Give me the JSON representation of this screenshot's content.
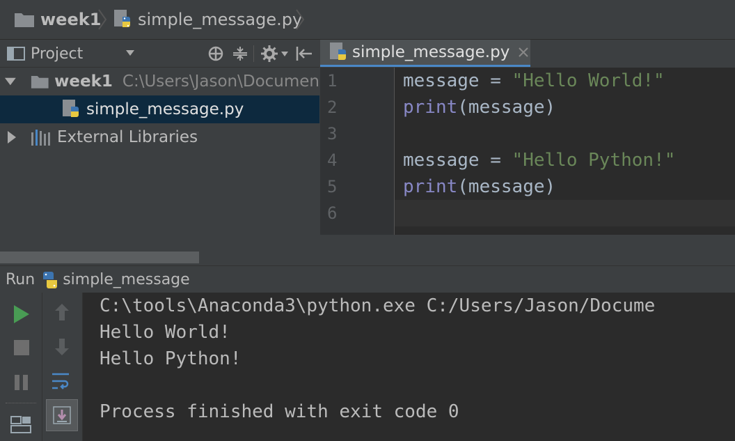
{
  "breadcrumb": {
    "project": "week1",
    "file": "simple_message.py"
  },
  "project_panel": {
    "title": "Project",
    "tree": [
      {
        "label": "week1",
        "path": "C:\\Users\\Jason\\Documen"
      },
      {
        "label": "simple_message.py"
      },
      {
        "label": "External Libraries"
      }
    ]
  },
  "editor": {
    "tab_label": "simple_message.py",
    "line_numbers": [
      "1",
      "2",
      "3",
      "4",
      "5",
      "6"
    ],
    "code": {
      "l1_var": "message = ",
      "l1_str": "\"Hello World!\"",
      "l2_kw": "print",
      "l2_rest": "(message)",
      "l4_var": "message = ",
      "l4_str": "\"Hello Python!\"",
      "l5_kw": "print",
      "l5_rest": "(message)"
    }
  },
  "run_panel": {
    "title": "Run",
    "config": "simple_message",
    "output": [
      "C:\\tools\\Anaconda3\\python.exe C:/Users/Jason/Docume",
      "Hello World!",
      "Hello Python!",
      "",
      "Process finished with exit code 0"
    ]
  },
  "colors": {
    "string": "#6a8759",
    "keyword": "#8888c6",
    "run_green": "#499c54",
    "selection": "#0d293e"
  }
}
